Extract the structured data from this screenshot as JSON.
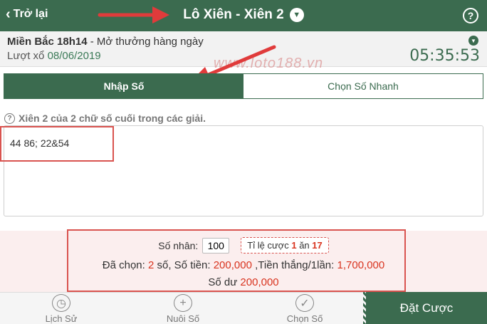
{
  "header": {
    "back_label": "Trở lại",
    "title": "Lô Xiên - Xiên 2",
    "help_glyph": "?"
  },
  "draw": {
    "region": "Miền Bắc 18h14",
    "separator": " - ",
    "schedule": "Mở thưởng hàng ngày",
    "date_label": "Lượt xổ",
    "date": "08/06/2019",
    "countdown": "05:35:53"
  },
  "watermark": "www.loto188.vn",
  "tabs": [
    {
      "label": "Nhập Số",
      "active": true
    },
    {
      "label": "Chọn Số Nhanh",
      "active": false
    }
  ],
  "instruction": "Xiên 2 của 2 chữ số cuối trong các giải.",
  "number_input": {
    "value": "44 86; 22&54"
  },
  "summary": {
    "multiplier_label": "Số nhân:",
    "multiplier_value": "100",
    "rate_prefix": "Tỉ lệ cược",
    "rate_stake": "1",
    "rate_mid": "ăn",
    "rate_win": "17",
    "picked_label": "Đã chọn:",
    "picked_count": "2",
    "picked_unit": "số, Số tiền:",
    "amount": "200,000",
    "win_label": ",Tiền thắng/1lần:",
    "win_amount": "1,700,000",
    "balance_label": "Số dư",
    "balance": "200,000"
  },
  "nav": {
    "history": "Lịch Sử",
    "nuoi": "Nuôi Số",
    "pick": "Chọn Số",
    "bet": "Đặt Cược"
  },
  "colors": {
    "primary": "#3b6b4f",
    "accent_red": "#d9341f",
    "annotation": "#d9534f"
  }
}
